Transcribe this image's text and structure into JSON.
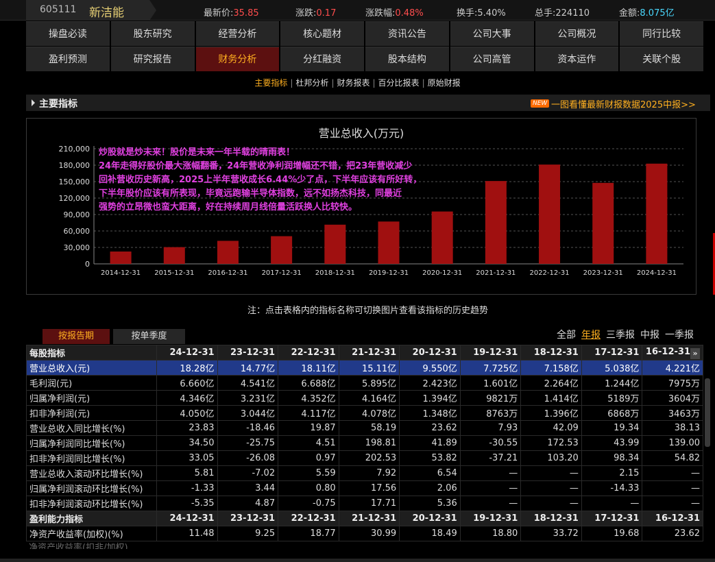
{
  "quote": {
    "code": "605111",
    "name": "新洁能",
    "latest_label": "最新价:",
    "latest": "35.85",
    "change_label": "涨跌:",
    "change": "0.17",
    "pct_label": "涨跌幅:",
    "pct": "0.48%",
    "turnover_label": "换手:",
    "turnover": "5.40%",
    "volume_label": "总手:",
    "volume": "224110",
    "amount_label": "金额:",
    "amount": "8.075亿"
  },
  "nav": {
    "row1": [
      "操盘必读",
      "股东研究",
      "经营分析",
      "核心题材",
      "资讯公告",
      "公司大事",
      "公司概况",
      "同行比较"
    ],
    "row2": [
      "盈利预测",
      "研究报告",
      "财务分析",
      "分红融资",
      "股本结构",
      "公司高管",
      "资本运作",
      "关联个股"
    ],
    "active": "财务分析"
  },
  "subnav": {
    "items": [
      "主要指标",
      "杜邦分析",
      "财务报表",
      "百分比报表",
      "原始财报"
    ],
    "active": "主要指标"
  },
  "section": {
    "title": "主要指标",
    "new_tag": "NEW",
    "link": "一图看懂最新财报数据2025中报>>"
  },
  "chart_data": {
    "type": "bar",
    "title": "营业总收入(万元)",
    "categories": [
      "2014-12-31",
      "2015-12-31",
      "2016-12-31",
      "2017-12-31",
      "2018-12-31",
      "2019-12-31",
      "2020-12-31",
      "2021-12-31",
      "2022-12-31",
      "2023-12-31",
      "2024-12-31"
    ],
    "values": [
      22500,
      30500,
      42000,
      50500,
      71500,
      77200,
      95500,
      151100,
      181100,
      147700,
      182800
    ],
    "yticks": [
      "0",
      "30,000",
      "60,000",
      "90,000",
      "120,000",
      "150,000",
      "180,000",
      "210,000"
    ],
    "ylim": [
      0,
      210000
    ],
    "grid": true,
    "color": "#a01010"
  },
  "overlay_text": [
    "炒股就是炒未来！股价是未来一年半载的晴雨表！",
    "24年走得好股价最大涨幅翻番，24年营收净利润增幅还不错，把23年营收减少",
    "回补营收历史新高，2025上半年营收成长6.44%少了点，下半年应该有所好转，",
    "下半年股价应该有所表现，毕竟远跑输半导体指数，远不如扬杰科技，同最近",
    "强势的立昂微也蛮大距离，好在持续周月线倍量活跃换人比较快。"
  ],
  "note": "注：点击表格内的指标名称可切换图片查看该指标的历史趋势",
  "tabs": {
    "report": "按报告期",
    "quarter": "按单季度"
  },
  "periods": [
    "全部",
    "年报",
    "三季报",
    "中报",
    "一季报"
  ],
  "period_active": "年报",
  "table": {
    "columns": [
      "24-12-31",
      "23-12-31",
      "22-12-31",
      "21-12-31",
      "20-12-31",
      "19-12-31",
      "18-12-31",
      "17-12-31",
      "16-12-31"
    ],
    "group1": "每股指标",
    "rows1": [
      {
        "label": "营业总收入(元)",
        "values": [
          "18.28亿",
          "14.77亿",
          "18.11亿",
          "15.11亿",
          "9.550亿",
          "7.725亿",
          "7.158亿",
          "5.038亿",
          "4.221亿"
        ]
      },
      {
        "label": "毛利润(元)",
        "values": [
          "6.660亿",
          "4.541亿",
          "6.688亿",
          "5.895亿",
          "2.423亿",
          "1.601亿",
          "2.264亿",
          "1.244亿",
          "7975万"
        ]
      },
      {
        "label": "归属净利润(元)",
        "values": [
          "4.346亿",
          "3.231亿",
          "4.352亿",
          "4.164亿",
          "1.394亿",
          "9821万",
          "1.414亿",
          "5189万",
          "3604万"
        ]
      },
      {
        "label": "扣非净利润(元)",
        "values": [
          "4.050亿",
          "3.044亿",
          "4.117亿",
          "4.078亿",
          "1.348亿",
          "8763万",
          "1.396亿",
          "6868万",
          "3463万"
        ]
      },
      {
        "label": "营业总收入同比增长(%)",
        "values": [
          "23.83",
          "-18.46",
          "19.87",
          "58.19",
          "23.62",
          "7.93",
          "42.09",
          "19.34",
          "38.13"
        ]
      },
      {
        "label": "归属净利润同比增长(%)",
        "values": [
          "34.50",
          "-25.75",
          "4.51",
          "198.81",
          "41.89",
          "-30.55",
          "172.53",
          "43.99",
          "139.00"
        ]
      },
      {
        "label": "扣非净利润同比增长(%)",
        "values": [
          "33.05",
          "-26.08",
          "0.97",
          "202.53",
          "53.82",
          "-37.21",
          "103.20",
          "98.34",
          "54.82"
        ]
      },
      {
        "label": "营业总收入滚动环比增长(%)",
        "values": [
          "5.81",
          "-7.02",
          "5.59",
          "7.92",
          "6.54",
          "—",
          "—",
          "2.15",
          "—"
        ]
      },
      {
        "label": "归属净利润滚动环比增长(%)",
        "values": [
          "-1.33",
          "3.44",
          "0.80",
          "17.56",
          "2.06",
          "—",
          "—",
          "-14.33",
          "—"
        ]
      },
      {
        "label": "扣非净利润滚动环比增长(%)",
        "values": [
          "-5.35",
          "4.87",
          "-0.75",
          "17.71",
          "5.36",
          "—",
          "—",
          "—",
          "—"
        ]
      }
    ],
    "group2": "盈利能力指标",
    "rows2": [
      {
        "label": "净资产收益率(加权)(%)",
        "values": [
          "11.48",
          "9.25",
          "18.77",
          "30.99",
          "18.49",
          "18.80",
          "33.72",
          "19.68",
          "23.62"
        ]
      }
    ],
    "cut_row": "净资产收益率(扣非/加权)",
    "more_icon": "»"
  }
}
